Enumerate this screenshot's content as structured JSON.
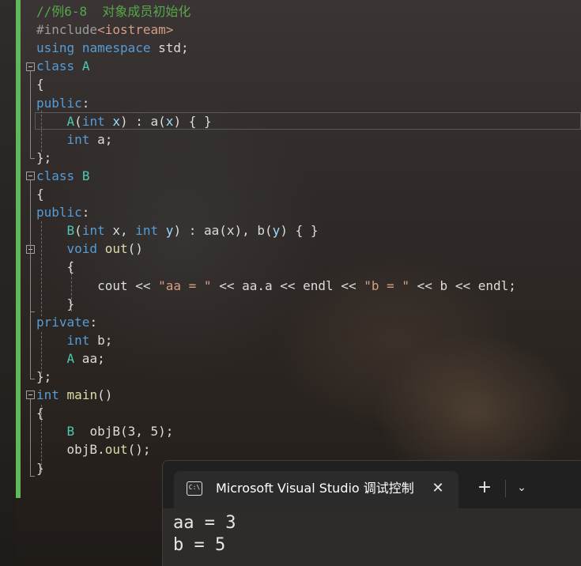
{
  "editor": {
    "lines": [
      [
        {
          "t": "//例6-8  对象成员初始化",
          "c": "cm"
        }
      ],
      [
        {
          "t": "#include",
          "c": "pp"
        },
        {
          "t": "<iostream>",
          "c": "st"
        }
      ],
      [
        {
          "t": "using",
          "c": "kw"
        },
        {
          "t": " ",
          "c": "id"
        },
        {
          "t": "namespace",
          "c": "kw"
        },
        {
          "t": " std;",
          "c": "id"
        }
      ],
      [
        {
          "t": "class",
          "c": "kw"
        },
        {
          "t": " ",
          "c": "id"
        },
        {
          "t": "A",
          "c": "ty"
        }
      ],
      [
        {
          "t": "{",
          "c": "id"
        }
      ],
      [
        {
          "t": "public",
          "c": "kw"
        },
        {
          "t": ":",
          "c": "id"
        }
      ],
      [
        {
          "t": "    ",
          "c": "id"
        },
        {
          "t": "A",
          "c": "ty"
        },
        {
          "t": "(",
          "c": "id"
        },
        {
          "t": "int",
          "c": "kw"
        },
        {
          "t": " ",
          "c": "id"
        },
        {
          "t": "x",
          "c": "pr"
        },
        {
          "t": ") : a(",
          "c": "id"
        },
        {
          "t": "x",
          "c": "pr"
        },
        {
          "t": ") { }",
          "c": "id"
        }
      ],
      [
        {
          "t": "    ",
          "c": "id"
        },
        {
          "t": "int",
          "c": "kw"
        },
        {
          "t": " a;",
          "c": "id"
        }
      ],
      [
        {
          "t": "};",
          "c": "id"
        }
      ],
      [
        {
          "t": "class",
          "c": "kw"
        },
        {
          "t": " ",
          "c": "id"
        },
        {
          "t": "B",
          "c": "ty"
        }
      ],
      [
        {
          "t": "{",
          "c": "id"
        }
      ],
      [
        {
          "t": "public",
          "c": "kw"
        },
        {
          "t": ":",
          "c": "id"
        }
      ],
      [
        {
          "t": "    ",
          "c": "id"
        },
        {
          "t": "B",
          "c": "ty"
        },
        {
          "t": "(",
          "c": "id"
        },
        {
          "t": "int",
          "c": "kw"
        },
        {
          "t": " x, ",
          "c": "id"
        },
        {
          "t": "int",
          "c": "kw"
        },
        {
          "t": " ",
          "c": "id"
        },
        {
          "t": "y",
          "c": "pr"
        },
        {
          "t": ") : aa(x), b(",
          "c": "id"
        },
        {
          "t": "y",
          "c": "pr"
        },
        {
          "t": ") { }",
          "c": "id"
        }
      ],
      [
        {
          "t": "    ",
          "c": "id"
        },
        {
          "t": "void",
          "c": "kw"
        },
        {
          "t": " ",
          "c": "id"
        },
        {
          "t": "out",
          "c": "fn"
        },
        {
          "t": "()",
          "c": "id"
        }
      ],
      [
        {
          "t": "    {",
          "c": "id"
        }
      ],
      [
        {
          "t": "        cout << ",
          "c": "id"
        },
        {
          "t": "\"aa = \"",
          "c": "st"
        },
        {
          "t": " << aa.a << endl << ",
          "c": "id"
        },
        {
          "t": "\"b = \"",
          "c": "st"
        },
        {
          "t": " << b << endl;",
          "c": "id"
        }
      ],
      [
        {
          "t": "    }",
          "c": "id"
        }
      ],
      [
        {
          "t": "private",
          "c": "kw"
        },
        {
          "t": ":",
          "c": "id"
        }
      ],
      [
        {
          "t": "    ",
          "c": "id"
        },
        {
          "t": "int",
          "c": "kw"
        },
        {
          "t": " b;",
          "c": "id"
        }
      ],
      [
        {
          "t": "    ",
          "c": "id"
        },
        {
          "t": "A",
          "c": "ty"
        },
        {
          "t": " aa;",
          "c": "id"
        }
      ],
      [
        {
          "t": "};",
          "c": "id"
        }
      ],
      [
        {
          "t": "int",
          "c": "kw"
        },
        {
          "t": " ",
          "c": "id"
        },
        {
          "t": "main",
          "c": "fn"
        },
        {
          "t": "()",
          "c": "id"
        }
      ],
      [
        {
          "t": "{",
          "c": "id"
        }
      ],
      [
        {
          "t": "    ",
          "c": "id"
        },
        {
          "t": "B",
          "c": "ty"
        },
        {
          "t": "  objB(3, 5);",
          "c": "id"
        }
      ],
      [
        {
          "t": "    objB.",
          "c": "id"
        },
        {
          "t": "out",
          "c": "fn"
        },
        {
          "t": "();",
          "c": "id"
        }
      ],
      [
        {
          "t": "}",
          "c": "id"
        }
      ]
    ]
  },
  "terminal": {
    "tab_icon": "C:\\",
    "tab_title": "Microsoft Visual Studio 调试控制台",
    "close_glyph": "✕",
    "new_tab_glyph": "+",
    "dropdown_glyph": "⌄",
    "output": [
      "aa = 3",
      "b = 5"
    ]
  },
  "colors": {
    "accent_green": "#5fb85a",
    "keyword": "#569cd6",
    "comment": "#57a64a",
    "type": "#4ec9b0",
    "string": "#d69d85",
    "function": "#dcdcaa"
  }
}
